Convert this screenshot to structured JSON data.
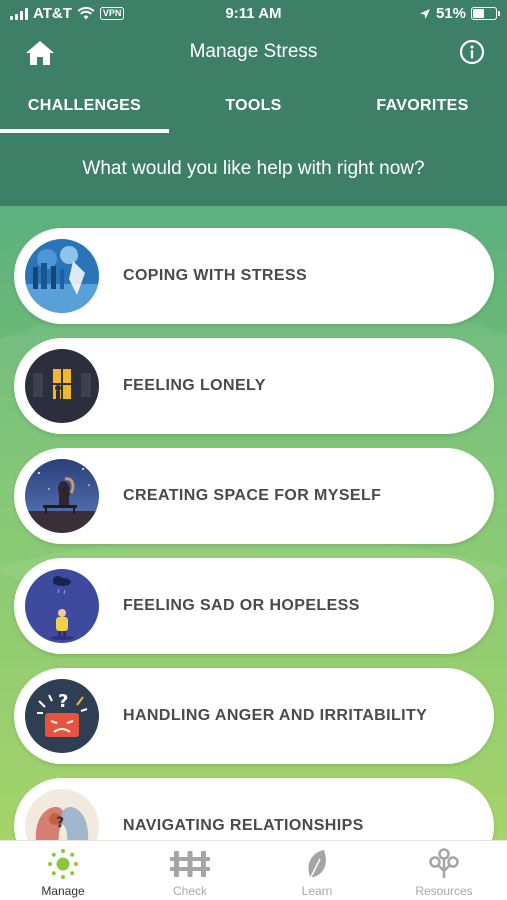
{
  "status_bar": {
    "carrier": "AT&T",
    "vpn": "VPN",
    "time": "9:11 AM",
    "battery": "51%",
    "battery_level": 0.51
  },
  "nav": {
    "title": "Manage Stress",
    "home_icon": "home-icon",
    "info_icon": "info-icon"
  },
  "tabs": [
    {
      "label": "CHALLENGES",
      "active": true
    },
    {
      "label": "TOOLS",
      "active": false
    },
    {
      "label": "FAVORITES",
      "active": false
    }
  ],
  "prompt": "What would you like help with right now?",
  "challenges": [
    {
      "label": "COPING WITH STRESS",
      "icon": "stress-illustration"
    },
    {
      "label": "FEELING LONELY",
      "icon": "lonely-window-illustration"
    },
    {
      "label": "CREATING SPACE FOR MYSELF",
      "icon": "person-on-bench-illustration"
    },
    {
      "label": "FEELING SAD OR HOPELESS",
      "icon": "rain-cloud-illustration"
    },
    {
      "label": "HANDLING ANGER AND IRRITABILITY",
      "icon": "angry-face-illustration"
    },
    {
      "label": "NAVIGATING RELATIONSHIPS",
      "icon": "faces-illustration"
    }
  ],
  "tabbar": [
    {
      "label": "Manage",
      "icon": "sun-icon",
      "active": true
    },
    {
      "label": "Check",
      "icon": "fence-icon",
      "active": false
    },
    {
      "label": "Learn",
      "icon": "leaf-icon",
      "active": false
    },
    {
      "label": "Resources",
      "icon": "tree-icon",
      "active": false
    }
  ],
  "colors": {
    "header": "#3e7f68",
    "accent": "#8cc63f",
    "card_text": "#4a4a4a"
  }
}
